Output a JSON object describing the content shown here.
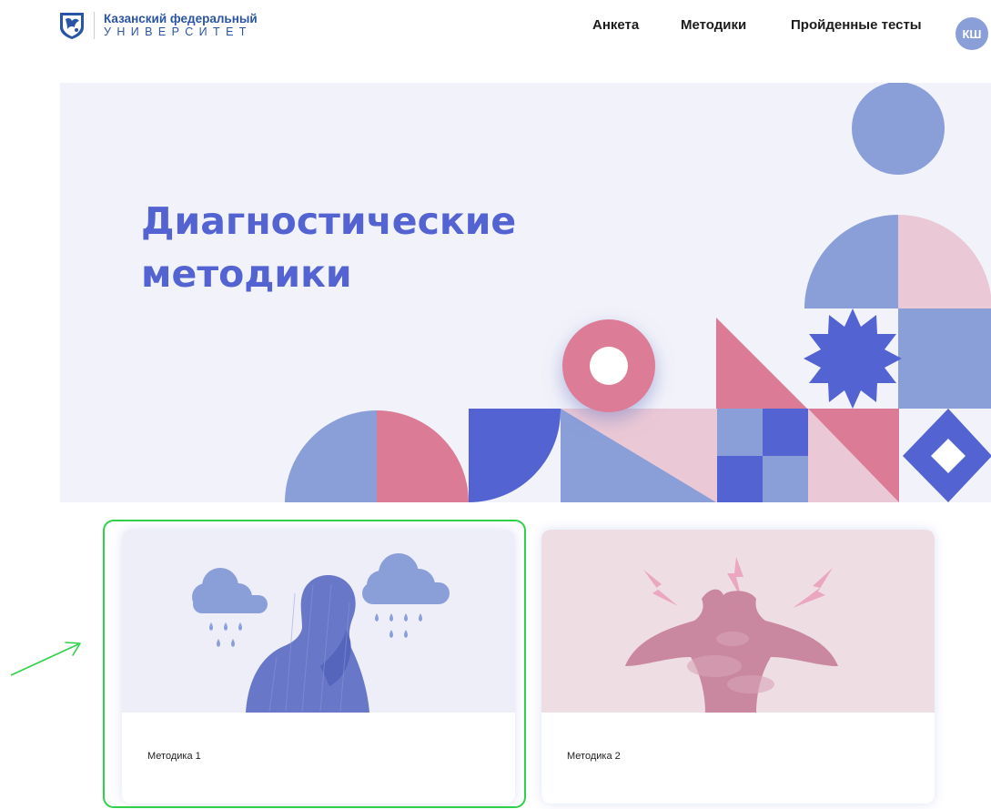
{
  "header": {
    "logo": {
      "line1": "Казанский федеральный",
      "line2": "УНИВЕРСИТЕТ"
    },
    "nav": [
      {
        "label": "Анкета"
      },
      {
        "label": "Методики"
      },
      {
        "label": "Пройденные тесты"
      }
    ],
    "avatar_initials": "КШ"
  },
  "hero": {
    "title": "Диагностические методики"
  },
  "cards": [
    {
      "label": "Методика 1",
      "image_icon": "sad-person-rain-clouds"
    },
    {
      "label": "Методика 2",
      "image_icon": "stressed-person-lightning"
    }
  ],
  "colors": {
    "brand_blue": "#2a54a6",
    "accent_indigo": "#5363d2",
    "periwinkle": "#8a9ed8",
    "rose": "#dc7b96",
    "pink_light": "#ebc8d5",
    "highlight_green": "#2fd14a"
  }
}
